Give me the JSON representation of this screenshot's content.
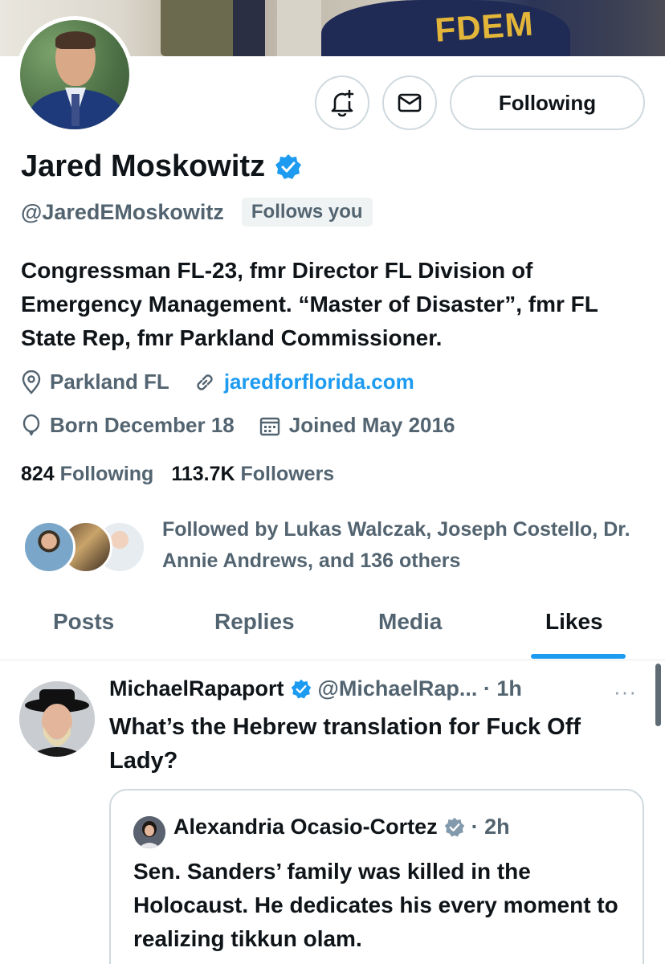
{
  "banner": {
    "text": "FDEM"
  },
  "profile": {
    "follow_label": "Following",
    "name": "Jared Moskowitz",
    "handle": "@JaredEMoskowitz",
    "follows_you": "Follows you",
    "bio": "Congressman FL-23, fmr Director FL Division of Emergency Management. “Master of Disaster”, fmr FL State Rep, fmr Parkland Commissioner.",
    "location": "Parkland FL",
    "website": "jaredforflorida.com",
    "birthday": "Born December 18",
    "joined": "Joined May 2016",
    "following_count": "824",
    "following_label": "Following",
    "followers_count": "113.7K",
    "followers_label": "Followers",
    "followed_by": "Followed by Lukas Walczak, Joseph Costello, Dr. Annie Andrews, and 136 others"
  },
  "tabs": [
    {
      "label": "Posts",
      "active": false
    },
    {
      "label": "Replies",
      "active": false
    },
    {
      "label": "Media",
      "active": false
    },
    {
      "label": "Likes",
      "active": true
    }
  ],
  "tweet": {
    "author": "MichaelRapaport",
    "handle_time": "@MichaelRap... · 1h",
    "more": "···",
    "text": "What’s the Hebrew translation for Fuck Off Lady?",
    "quote": {
      "author": "Alexandria Ocasio-Cortez",
      "time": "· 2h",
      "text": "Sen. Sanders’ family was killed in the Holocaust. He dedicates his every moment to realizing tikkun olam."
    }
  },
  "colors": {
    "accent": "#1d9bf0",
    "muted": "#536471",
    "text": "#0f1419",
    "border": "#cfd9de"
  },
  "icons": [
    "bell-plus-icon",
    "mail-icon",
    "verified-badge-icon",
    "location-pin-icon",
    "link-icon",
    "balloon-icon",
    "calendar-icon",
    "more-icon",
    "gray-verified-badge-icon"
  ]
}
